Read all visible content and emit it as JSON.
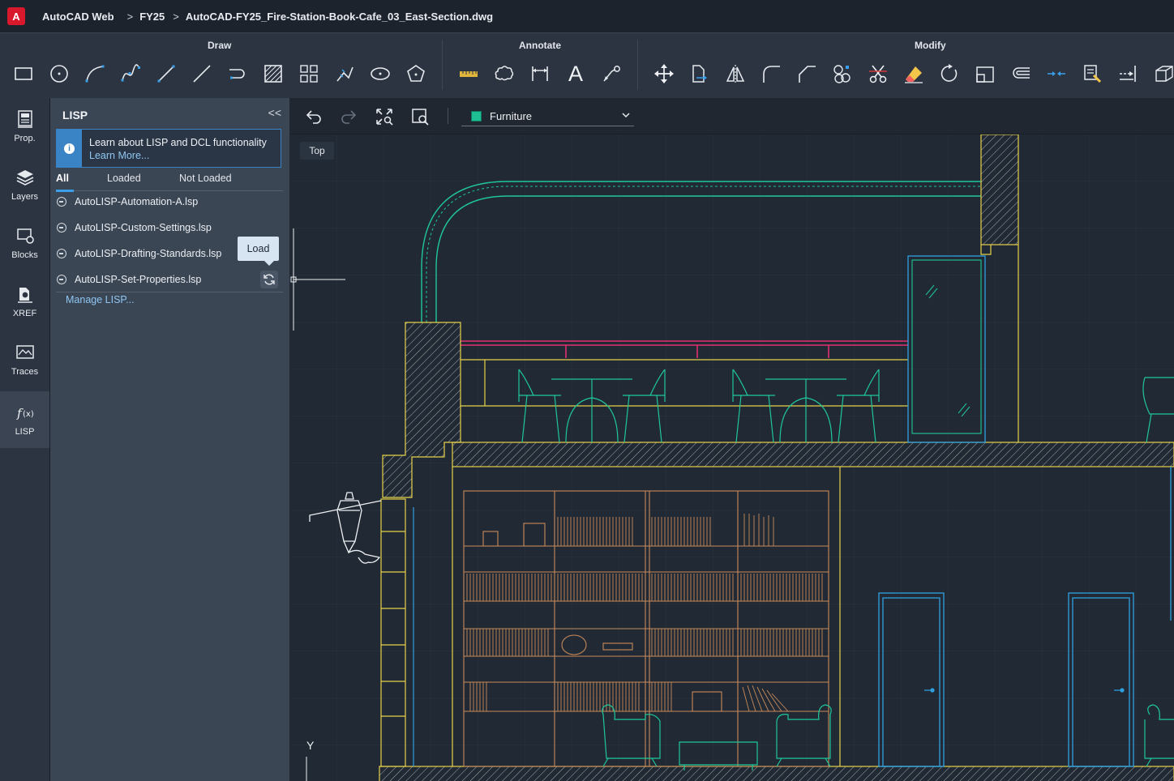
{
  "titlebar": {
    "logo_letter": "A",
    "app_name": "AutoCAD Web",
    "folder": "FY25",
    "file_name": "AutoCAD-FY25_Fire-Station-Book-Cafe_03_East-Section.dwg",
    "separator": ">"
  },
  "ribbon": {
    "groups": {
      "draw": "Draw",
      "annotate": "Annotate",
      "modify": "Modify"
    },
    "draw_tools": [
      "rectangle-icon",
      "circle-icon",
      "arc-icon",
      "spline-icon",
      "line-icon",
      "polyline-icon",
      "polyline-arc-icon",
      "hatch-icon",
      "array-icon",
      "polyline-edit-icon",
      "ellipse-icon",
      "polygon-icon"
    ],
    "annotate_tools": [
      "measure-icon",
      "revision-cloud-icon",
      "dimension-icon",
      "text-icon",
      "leader-icon"
    ],
    "annotate_text_glyph": "A",
    "modify_tools": [
      "move-icon",
      "copy-icon",
      "mirror-icon",
      "fillet-icon",
      "chamfer-icon",
      "join-icon",
      "trim-icon",
      "erase-icon",
      "rotate-icon",
      "scale-icon",
      "offset-icon",
      "break-icon",
      "match-properties-icon",
      "extend-icon",
      "3d-box-icon"
    ]
  },
  "leftbar": {
    "items": [
      {
        "label": "Prop.",
        "icon": "properties-icon"
      },
      {
        "label": "Layers",
        "icon": "layers-icon"
      },
      {
        "label": "Blocks",
        "icon": "blocks-icon"
      },
      {
        "label": "XREF",
        "icon": "xref-icon"
      },
      {
        "label": "Traces",
        "icon": "traces-icon"
      },
      {
        "label": "LISP",
        "icon": "lisp-icon",
        "active": true
      }
    ]
  },
  "lisp_panel": {
    "title": "LISP",
    "collapse_glyph": "<<",
    "info_text": "Learn about LISP and DCL functionality",
    "info_link": "Learn More...",
    "info_glyph": "i",
    "tabs": [
      "All",
      "Loaded",
      "Not Loaded"
    ],
    "active_tab": "All",
    "files": [
      "AutoLISP-Automation-A.lsp",
      "AutoLISP-Custom-Settings.lsp",
      "AutoLISP-Drafting-Standards.lsp",
      "AutoLISP-Set-Properties.lsp"
    ],
    "load_tooltip": "Load",
    "manage_link": "Manage LISP..."
  },
  "canvas_toolbar": {
    "layer_name": "Furniture",
    "layer_color": "#1dbf93"
  },
  "canvas": {
    "view_label": "Top",
    "ucs_axis_label": "Y"
  },
  "colors": {
    "accent_blue": "#3a9ee8",
    "brand_red": "#d8182b",
    "cad_yellow": "#e6d24a",
    "cad_teal": "#1fc79a",
    "cad_orange": "#c98a5a",
    "cad_cyan": "#2f9fe0",
    "cad_magenta": "#e0306e"
  }
}
